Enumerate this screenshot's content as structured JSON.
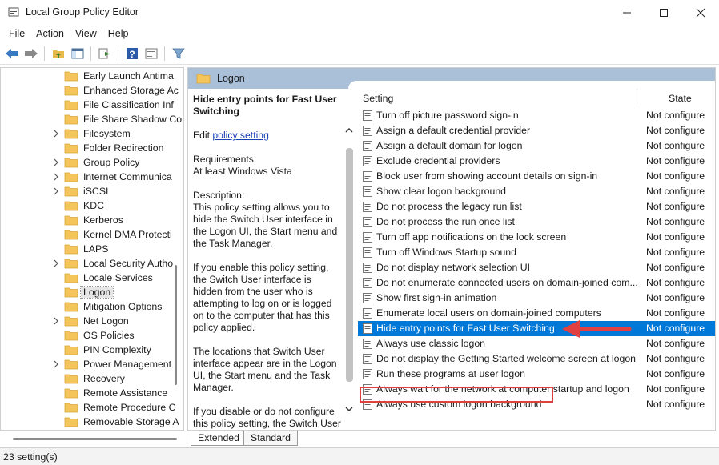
{
  "window": {
    "title": "Local Group Policy Editor",
    "controls": {
      "minimize": "—",
      "maximize": "☐",
      "close": "✕"
    }
  },
  "menu": [
    "File",
    "Action",
    "View",
    "Help"
  ],
  "toolbar": {
    "icons": [
      "back-arrow-icon",
      "forward-arrow-icon",
      "up-folder-icon",
      "show-hide-tree-icon",
      "export-list-icon",
      "help-icon",
      "properties-icon",
      "filter-icon"
    ]
  },
  "tree": {
    "items": [
      {
        "label": "Early Launch Antima",
        "expandable": false,
        "selected": false
      },
      {
        "label": "Enhanced Storage Ac",
        "expandable": false,
        "selected": false
      },
      {
        "label": "File Classification Inf",
        "expandable": false,
        "selected": false
      },
      {
        "label": "File Share Shadow Co",
        "expandable": false,
        "selected": false
      },
      {
        "label": "Filesystem",
        "expandable": true,
        "selected": false
      },
      {
        "label": "Folder Redirection",
        "expandable": false,
        "selected": false
      },
      {
        "label": "Group Policy",
        "expandable": true,
        "selected": false
      },
      {
        "label": "Internet Communica",
        "expandable": true,
        "selected": false
      },
      {
        "label": "iSCSI",
        "expandable": true,
        "selected": false
      },
      {
        "label": "KDC",
        "expandable": false,
        "selected": false
      },
      {
        "label": "Kerberos",
        "expandable": false,
        "selected": false
      },
      {
        "label": "Kernel DMA Protecti",
        "expandable": false,
        "selected": false
      },
      {
        "label": "LAPS",
        "expandable": false,
        "selected": false
      },
      {
        "label": "Local Security Autho",
        "expandable": true,
        "selected": false
      },
      {
        "label": "Locale Services",
        "expandable": false,
        "selected": false
      },
      {
        "label": "Logon",
        "expandable": false,
        "selected": true
      },
      {
        "label": "Mitigation Options",
        "expandable": false,
        "selected": false
      },
      {
        "label": "Net Logon",
        "expandable": true,
        "selected": false
      },
      {
        "label": "OS Policies",
        "expandable": false,
        "selected": false
      },
      {
        "label": "PIN Complexity",
        "expandable": false,
        "selected": false
      },
      {
        "label": "Power Management",
        "expandable": true,
        "selected": false
      },
      {
        "label": "Recovery",
        "expandable": false,
        "selected": false
      },
      {
        "label": "Remote Assistance",
        "expandable": false,
        "selected": false
      },
      {
        "label": "Remote Procedure C",
        "expandable": false,
        "selected": false
      },
      {
        "label": "Removable Storage A",
        "expandable": false,
        "selected": false
      }
    ]
  },
  "detail": {
    "header": "Logon",
    "title": "Hide entry points for Fast User Switching",
    "edit_prefix": "Edit ",
    "edit_link": "policy setting",
    "requirements_label": "Requirements:",
    "requirements_value": "At least Windows Vista",
    "description_label": "Description:",
    "description_1": "This policy setting allows you to hide the Switch User interface in the Logon UI, the Start menu and the Task Manager.",
    "description_2": "If you enable this policy setting, the Switch User interface is hidden from the user who is attempting to log on or is logged on to the computer that has this policy applied.",
    "description_3": "The locations that Switch User interface appear are in the Logon UI, the Start menu and the Task Manager.",
    "description_4": "If you disable or do not configure this policy setting, the Switch User"
  },
  "list": {
    "col_setting": "Setting",
    "col_state": "State",
    "rows": [
      {
        "name": "Turn off picture password sign-in",
        "state": "Not configure",
        "selected": false
      },
      {
        "name": "Assign a default credential provider",
        "state": "Not configure",
        "selected": false
      },
      {
        "name": "Assign a default domain for logon",
        "state": "Not configure",
        "selected": false
      },
      {
        "name": "Exclude credential providers",
        "state": "Not configure",
        "selected": false
      },
      {
        "name": "Block user from showing account details on sign-in",
        "state": "Not configure",
        "selected": false
      },
      {
        "name": "Show clear logon background",
        "state": "Not configure",
        "selected": false
      },
      {
        "name": "Do not process the legacy run list",
        "state": "Not configure",
        "selected": false
      },
      {
        "name": "Do not process the run once list",
        "state": "Not configure",
        "selected": false
      },
      {
        "name": "Turn off app notifications on the lock screen",
        "state": "Not configure",
        "selected": false
      },
      {
        "name": "Turn off Windows Startup sound",
        "state": "Not configure",
        "selected": false
      },
      {
        "name": "Do not display network selection UI",
        "state": "Not configure",
        "selected": false
      },
      {
        "name": "Do not enumerate connected users on domain-joined com...",
        "state": "Not configure",
        "selected": false
      },
      {
        "name": "Show first sign-in animation",
        "state": "Not configure",
        "selected": false
      },
      {
        "name": "Enumerate local users on domain-joined computers",
        "state": "Not configure",
        "selected": false
      },
      {
        "name": "Hide entry points for Fast User Switching",
        "state": "Not configure",
        "selected": true
      },
      {
        "name": "Always use classic logon",
        "state": "Not configure",
        "selected": false
      },
      {
        "name": "Do not display the Getting Started welcome screen at logon",
        "state": "Not configure",
        "selected": false
      },
      {
        "name": "Run these programs at user logon",
        "state": "Not configure",
        "selected": false
      },
      {
        "name": "Always wait for the network at computer startup and logon",
        "state": "Not configure",
        "selected": false
      },
      {
        "name": "Always use custom logon background",
        "state": "Not configure",
        "selected": false
      }
    ]
  },
  "tabs": {
    "extended": "Extended",
    "standard": "Standard"
  },
  "status": "23 setting(s)",
  "colors": {
    "selection": "#0078d7",
    "header_band": "#a9c0d8",
    "annotation": "#e04040",
    "link": "#1a3fb3"
  }
}
